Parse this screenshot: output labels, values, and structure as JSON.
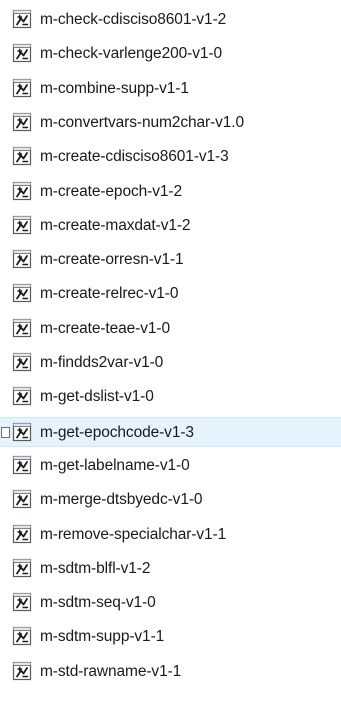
{
  "files": [
    {
      "name": "m-check-cdisciso8601-v1-2",
      "selected": false,
      "icon": "sas-program-icon"
    },
    {
      "name": "m-check-varlenge200-v1-0",
      "selected": false,
      "icon": "sas-program-icon"
    },
    {
      "name": "m-combine-supp-v1-1",
      "selected": false,
      "icon": "sas-program-icon"
    },
    {
      "name": "m-convertvars-num2char-v1.0",
      "selected": false,
      "icon": "sas-program-icon"
    },
    {
      "name": "m-create-cdisciso8601-v1-3",
      "selected": false,
      "icon": "sas-program-icon"
    },
    {
      "name": "m-create-epoch-v1-2",
      "selected": false,
      "icon": "sas-program-icon"
    },
    {
      "name": "m-create-maxdat-v1-2",
      "selected": false,
      "icon": "sas-program-icon"
    },
    {
      "name": "m-create-orresn-v1-1",
      "selected": false,
      "icon": "sas-program-icon"
    },
    {
      "name": "m-create-relrec-v1-0",
      "selected": false,
      "icon": "sas-program-icon"
    },
    {
      "name": "m-create-teae-v1-0",
      "selected": false,
      "icon": "sas-program-icon"
    },
    {
      "name": "m-findds2var-v1-0",
      "selected": false,
      "icon": "sas-program-icon"
    },
    {
      "name": "m-get-dslist-v1-0",
      "selected": false,
      "icon": "sas-program-icon"
    },
    {
      "name": "m-get-epochcode-v1-3",
      "selected": true,
      "icon": "sas-program-icon"
    },
    {
      "name": "m-get-labelname-v1-0",
      "selected": false,
      "icon": "sas-program-icon"
    },
    {
      "name": "m-merge-dtsbyedc-v1-0",
      "selected": false,
      "icon": "sas-program-icon"
    },
    {
      "name": "m-remove-specialchar-v1-1",
      "selected": false,
      "icon": "sas-program-icon"
    },
    {
      "name": "m-sdtm-blfl-v1-2",
      "selected": false,
      "icon": "sas-program-icon"
    },
    {
      "name": "m-sdtm-seq-v1-0",
      "selected": false,
      "icon": "sas-program-icon"
    },
    {
      "name": "m-sdtm-supp-v1-1",
      "selected": false,
      "icon": "sas-program-icon"
    },
    {
      "name": "m-std-rawname-v1-1",
      "selected": false,
      "icon": "sas-program-icon"
    }
  ],
  "colors": {
    "selection_bg": "#e5f3ff",
    "selection_border": "#cce8ff",
    "text": "#1a1a1a"
  }
}
